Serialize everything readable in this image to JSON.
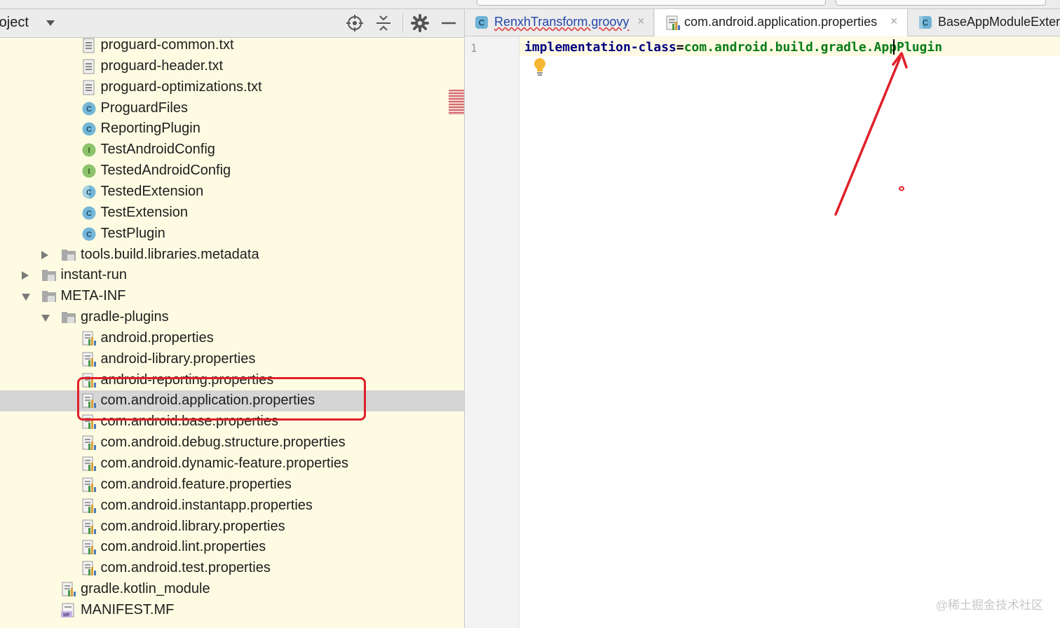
{
  "project_panel": {
    "title": "roject",
    "toolbar_icons": [
      "locate-icon",
      "collapse-all-icon",
      "gear-icon",
      "minimize-icon"
    ],
    "tree": [
      {
        "label": "proguard-common.txt",
        "icon": "text-file-icon",
        "expander": "none"
      },
      {
        "label": "proguard-header.txt",
        "icon": "text-file-icon",
        "expander": "none"
      },
      {
        "label": "proguard-optimizations.txt",
        "icon": "text-file-icon",
        "expander": "none"
      },
      {
        "label": "ProguardFiles",
        "icon": "class-icon",
        "expander": "none"
      },
      {
        "label": "ReportingPlugin",
        "icon": "class-icon",
        "expander": "none"
      },
      {
        "label": "TestAndroidConfig",
        "icon": "interface-icon",
        "expander": "none"
      },
      {
        "label": "TestedAndroidConfig",
        "icon": "interface-icon",
        "expander": "none"
      },
      {
        "label": "TestedExtension",
        "icon": "abstract-class-icon",
        "expander": "none"
      },
      {
        "label": "TestExtension",
        "icon": "class-icon",
        "expander": "none"
      },
      {
        "label": "TestPlugin",
        "icon": "class-icon",
        "expander": "none"
      },
      {
        "label": "tools.build.libraries.metadata",
        "icon": "folder-icon",
        "expander": "collapsed"
      },
      {
        "label": "instant-run",
        "icon": "folder-icon",
        "expander": "collapsed"
      },
      {
        "label": "META-INF",
        "icon": "folder-icon",
        "expander": "expanded"
      },
      {
        "label": "gradle-plugins",
        "icon": "folder-icon",
        "expander": "expanded"
      },
      {
        "label": "android.properties",
        "icon": "properties-file-icon",
        "expander": "none"
      },
      {
        "label": "android-library.properties",
        "icon": "properties-file-icon",
        "expander": "none"
      },
      {
        "label": "android-reporting.properties",
        "icon": "properties-file-icon",
        "expander": "none"
      },
      {
        "label": "com.android.application.properties",
        "icon": "properties-file-icon",
        "expander": "none",
        "selected": true
      },
      {
        "label": "com.android.base.properties",
        "icon": "properties-file-icon",
        "expander": "none"
      },
      {
        "label": "com.android.debug.structure.properties",
        "icon": "properties-file-icon",
        "expander": "none"
      },
      {
        "label": "com.android.dynamic-feature.properties",
        "icon": "properties-file-icon",
        "expander": "none"
      },
      {
        "label": "com.android.feature.properties",
        "icon": "properties-file-icon",
        "expander": "none"
      },
      {
        "label": "com.android.instantapp.properties",
        "icon": "properties-file-icon",
        "expander": "none"
      },
      {
        "label": "com.android.library.properties",
        "icon": "properties-file-icon",
        "expander": "none"
      },
      {
        "label": "com.android.lint.properties",
        "icon": "properties-file-icon",
        "expander": "none"
      },
      {
        "label": "com.android.test.properties",
        "icon": "properties-file-icon",
        "expander": "none"
      },
      {
        "label": "gradle.kotlin_module",
        "icon": "properties-file-icon",
        "expander": "none"
      },
      {
        "label": "MANIFEST.MF",
        "icon": "manifest-file-icon",
        "expander": "none"
      }
    ]
  },
  "editor": {
    "tabs": [
      {
        "label": "RenxhTransform.groovy",
        "icon": "class-icon",
        "active": false
      },
      {
        "label": "com.android.application.properties",
        "icon": "properties-file-icon",
        "active": true
      },
      {
        "label": "BaseAppModuleExter",
        "icon": "abstract-class-icon",
        "active": false
      }
    ],
    "close_glyph": "×",
    "line_number": "1",
    "code": {
      "key": "implementation-class",
      "equals": "=",
      "value": "com.android.build.gradle.AppPlugin"
    }
  },
  "watermark": "@稀土掘金技术社区",
  "colors": {
    "tree_background": "#fdfbe2",
    "selection": "#d5d5d5",
    "annotation_red": "#e0202a",
    "code_key": "#000080",
    "code_value": "#067d17"
  }
}
